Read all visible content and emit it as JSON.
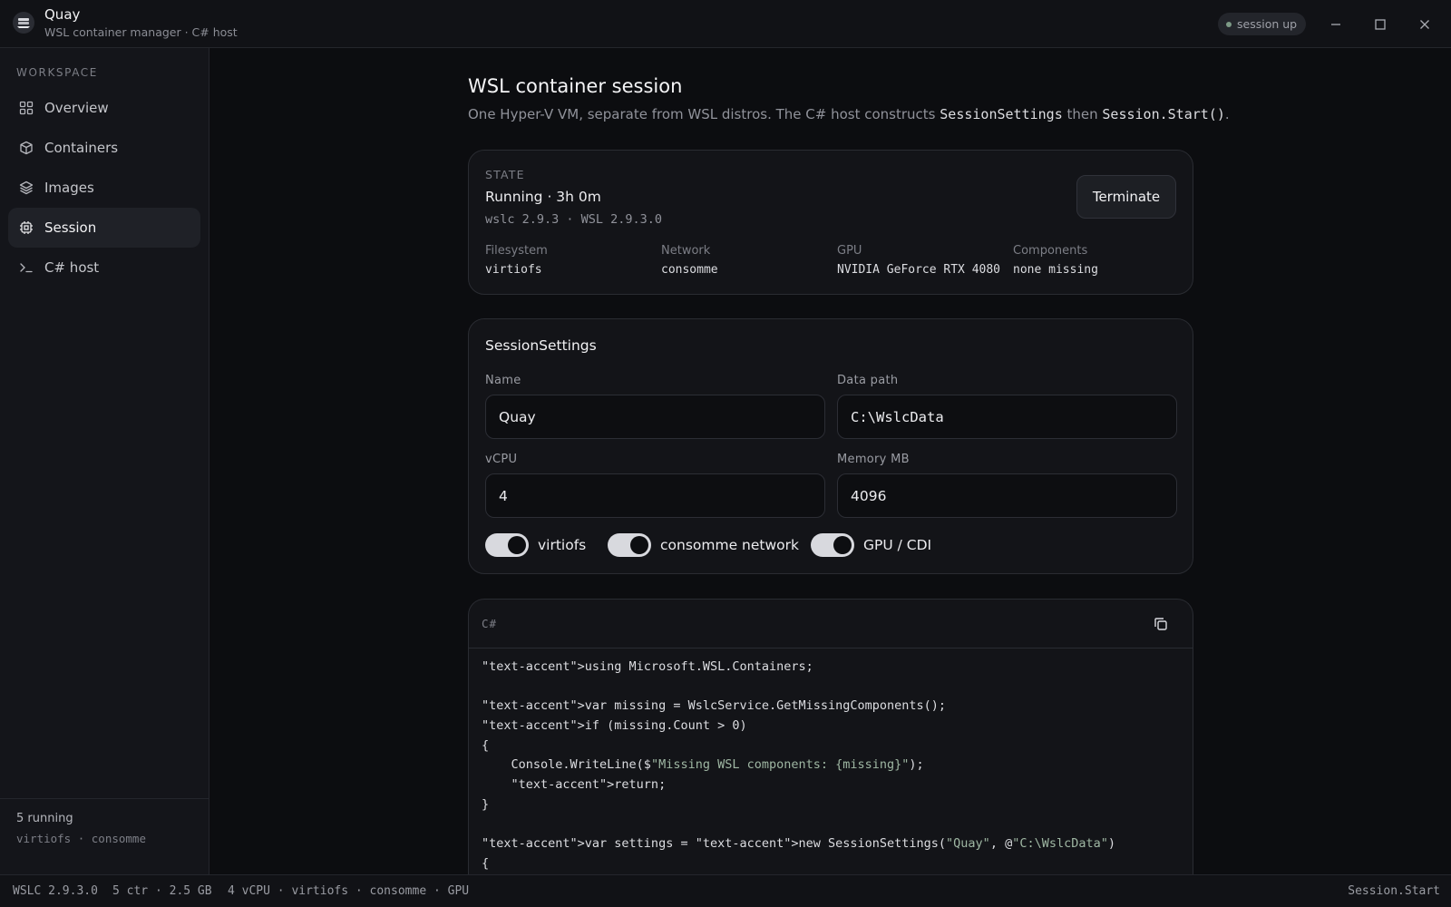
{
  "app": {
    "name": "Quay",
    "subtitle": "WSL container manager · C# host",
    "status_badge": "session up"
  },
  "sidebar": {
    "section_label": "WORKSPACE",
    "items": [
      {
        "label": "Overview",
        "icon": "grid-icon"
      },
      {
        "label": "Containers",
        "icon": "cube-icon"
      },
      {
        "label": "Images",
        "icon": "layers-icon"
      },
      {
        "label": "Session",
        "icon": "chip-icon",
        "active": true
      },
      {
        "label": "C# host",
        "icon": "terminal-icon"
      }
    ],
    "footer": {
      "count": "5 running",
      "tags": "virtiofs · consomme"
    }
  },
  "page": {
    "title": "WSL container session",
    "subtitle_prefix": "One Hyper-V VM, separate from WSL distros. The C# host constructs ",
    "subtitle_code1": "SessionSettings",
    "subtitle_mid": " then ",
    "subtitle_code2": "Session.Start()",
    "subtitle_suffix": "."
  },
  "state": {
    "label": "STATE",
    "value": "Running · 3h 0m",
    "versions": "wslc 2.9.3 · WSL 2.9.3.0",
    "terminate_label": "Terminate",
    "stats": [
      {
        "key": "Filesystem",
        "value": "virtiofs"
      },
      {
        "key": "Network",
        "value": "consomme"
      },
      {
        "key": "GPU",
        "value": "NVIDIA GeForce RTX 4080"
      },
      {
        "key": "Components",
        "value": "none missing"
      }
    ]
  },
  "settings": {
    "title": "SessionSettings",
    "name_label": "Name",
    "name_value": "Quay",
    "data_path_label": "Data path",
    "data_path_value": "C:\\WslcData",
    "vcpu_label": "vCPU",
    "vcpu_value": "4",
    "memory_label": "Memory MB",
    "memory_value": "4096",
    "toggles": [
      {
        "label": "virtiofs",
        "on": true
      },
      {
        "label": "consomme network",
        "on": true
      },
      {
        "label": "GPU / CDI",
        "on": true
      }
    ]
  },
  "code": {
    "lang": "C#",
    "lines": [
      [
        {
          "t": "\"text-accent\">using Microsoft.WSL.Containers;"
        }
      ],
      [
        {
          "t": ""
        }
      ],
      [
        {
          "t": "\"text-accent\">var missing = WslcService.GetMissingComponents();"
        }
      ],
      [
        {
          "t": "\"text-accent\">if (missing.Count > 0)"
        }
      ],
      [
        {
          "t": "{"
        }
      ],
      [
        {
          "t": "    Console.WriteLine($"
        },
        {
          "t": "\"Missing WSL components: {missing}\"",
          "s": true
        },
        {
          "t": ");"
        }
      ],
      [
        {
          "t": "    \"text-accent\">return;"
        }
      ],
      [
        {
          "t": "}"
        }
      ],
      [
        {
          "t": ""
        }
      ],
      [
        {
          "t": "\"text-accent\">var settings = \"text-accent\">new SessionSettings("
        },
        {
          "t": "\"Quay\"",
          "s": true
        },
        {
          "t": ", @"
        },
        {
          "t": "\"C:\\WslcData\"",
          "s": true
        },
        {
          "t": ")"
        }
      ],
      [
        {
          "t": "{"
        }
      ]
    ]
  },
  "statusbar": {
    "version": "WSLC 2.9.3.0",
    "usage": "5 ctr · 2.5 GB",
    "config": "4 vCPU · virtiofs · consomme · GPU",
    "right": "Session.Start"
  }
}
